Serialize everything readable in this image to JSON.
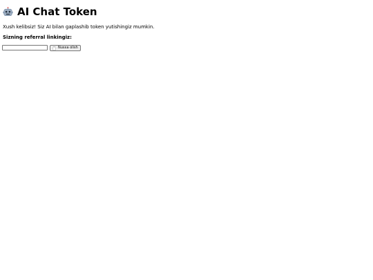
{
  "header": {
    "title": "AI Chat Token",
    "title_icon": "robot-icon"
  },
  "main": {
    "welcome_text": "Xush kelibsiz! Siz AI bilan gaplashib token yutishingiz mumkin.",
    "referral_label": "Sizning referral linkingiz:",
    "referral_input": {
      "value": "",
      "placeholder": ""
    },
    "copy_button": {
      "label": "Nusxa olish",
      "icon": "clipboard-icon"
    }
  },
  "colors": {
    "robot_face": "#7a8fa8",
    "robot_eyes": "#1e2a38",
    "button_bg": "#efefef",
    "border": "#767676"
  }
}
